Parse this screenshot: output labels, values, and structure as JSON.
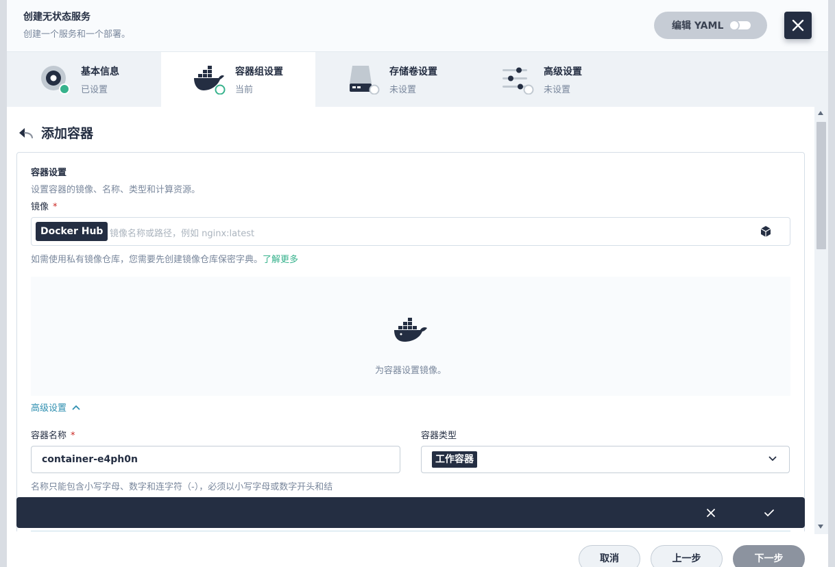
{
  "header": {
    "title": "创建无状态服务",
    "description": "创建一个服务和一个部署。",
    "yaml_toggle_label": "编辑 YAML",
    "yaml_enabled": false
  },
  "steps": [
    {
      "title": "基本信息",
      "status": "已设置",
      "icon": "disk-icon"
    },
    {
      "title": "容器组设置",
      "status": "当前",
      "icon": "docker-whale-icon"
    },
    {
      "title": "存储卷设置",
      "status": "未设置",
      "icon": "storage-volume-icon"
    },
    {
      "title": "高级设置",
      "status": "未设置",
      "icon": "sliders-icon"
    }
  ],
  "page": {
    "title": "添加容器"
  },
  "container_settings": {
    "section_title": "容器设置",
    "section_desc": "设置容器的镜像、名称、类型和计算资源。",
    "image_label": "镜像",
    "required_mark": "*",
    "registry_badge": "Docker Hub",
    "image_placeholder": "镜像名称或路径，例如 nginx:latest",
    "image_value": "",
    "private_hint": "如需使用私有镜像仓库，您需要先创建镜像仓库保密字典。",
    "learn_more": "了解更多",
    "empty_text": "为容器设置镜像。",
    "advanced_toggle": "高级设置",
    "name_label": "容器名称",
    "name_value": "container-e4ph0n",
    "type_label": "容器类型",
    "type_value": "工作容器",
    "name_hint": "名称只能包含小写字母、数字和连字符（-），必须以小写字母或数字开头和结"
  },
  "footer": {
    "cancel": "取消",
    "prev": "上一步",
    "next": "下一步"
  },
  "colors": {
    "dark": "#242e42",
    "success": "#36b28c",
    "muted": "#79879c",
    "link": "#2f8fb0"
  }
}
